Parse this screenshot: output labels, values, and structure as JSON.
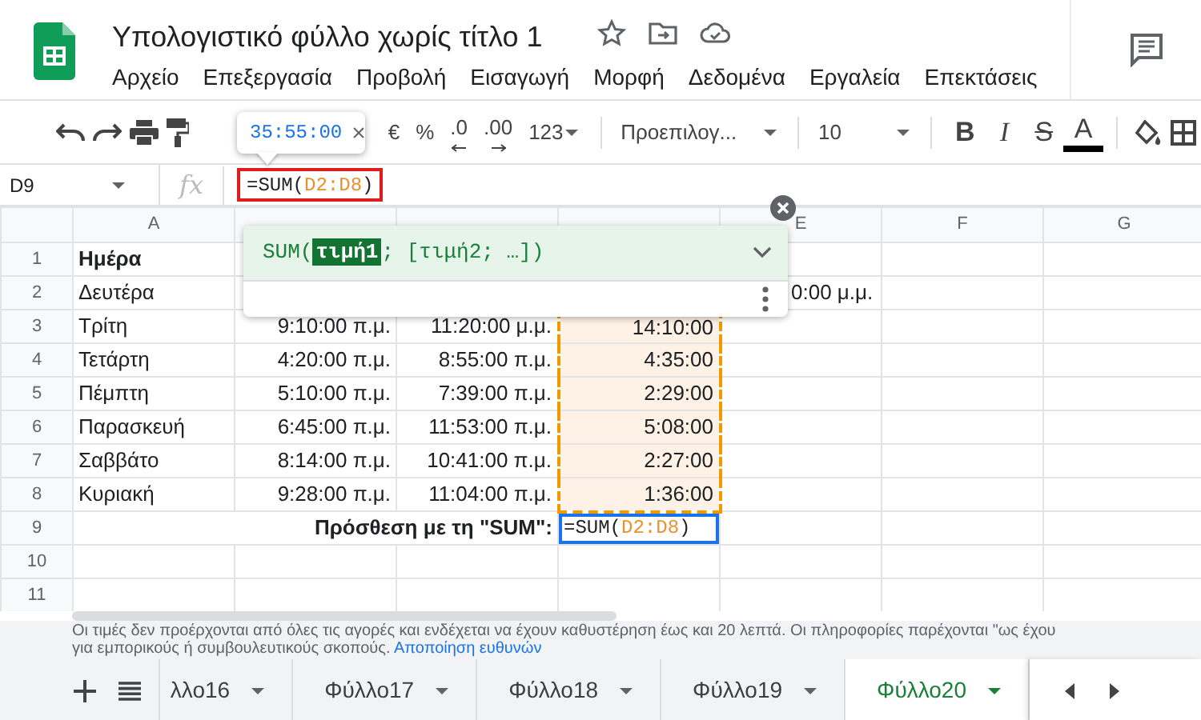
{
  "document": {
    "title": "Υπολογιστικό φύλλο χωρίς τίτλο 1"
  },
  "menu": [
    {
      "label": "Αρχείο"
    },
    {
      "label": "Επεξεργασία"
    },
    {
      "label": "Προβολή"
    },
    {
      "label": "Εισαγωγή"
    },
    {
      "label": "Μορφή"
    },
    {
      "label": "Δεδομένα"
    },
    {
      "label": "Εργαλεία"
    },
    {
      "label": "Επεκτάσεις"
    }
  ],
  "toolbar": {
    "number_formats": [
      {
        "text": "€",
        "kind": "plain"
      },
      {
        "text": "%",
        "kind": "plain"
      },
      {
        "text": ".0",
        "kind": "decrease"
      },
      {
        "text": ".00",
        "kind": "increase"
      },
      {
        "text": "123",
        "kind": "dropdown"
      }
    ],
    "font": "Προεπιλογ...",
    "font_size": "10",
    "text_styles": [
      {
        "text": "B",
        "kind": "bold"
      },
      {
        "text": "I",
        "kind": "italic"
      },
      {
        "text": "S",
        "kind": "strike"
      },
      {
        "text": "A",
        "kind": "color"
      }
    ]
  },
  "value_tooltip": {
    "text": "35:55:00",
    "close": "×"
  },
  "formula_bar": {
    "cell_ref": "D9",
    "fx": "fx",
    "formula": [
      {
        "text": "=SUM(",
        "kind": "plain"
      },
      {
        "text": "D2:D8",
        "kind": "ref"
      },
      {
        "text": ")",
        "kind": "plain"
      }
    ]
  },
  "columns": [
    {
      "label": "A"
    },
    {},
    {},
    {},
    {
      "label": "E"
    },
    {
      "label": "F"
    },
    {
      "label": "G"
    }
  ],
  "rows": [
    {
      "number": "1",
      "cells": [
        {
          "text": "Ημέρα",
          "kind": "header"
        },
        null,
        null,
        null,
        null,
        null,
        null
      ]
    },
    {
      "number": "2",
      "cells": [
        {
          "text": "Δευτέρα",
          "kind": "text"
        },
        null,
        null,
        null,
        {
          "text": "0:00 μ.μ.",
          "kind": "overflow"
        },
        null,
        null
      ]
    },
    {
      "number": "3",
      "cells": [
        {
          "text": "Τρίτη",
          "kind": "text"
        },
        {
          "text": "9:10:00 π.μ.",
          "kind": "time"
        },
        {
          "text": "11:20:00 μ.μ.",
          "kind": "time"
        },
        {
          "text": "14:10:00",
          "kind": "duration",
          "in_range": true
        },
        null,
        null,
        null
      ]
    },
    {
      "number": "4",
      "cells": [
        {
          "text": "Τετάρτη",
          "kind": "text"
        },
        {
          "text": "4:20:00 π.μ.",
          "kind": "time"
        },
        {
          "text": "8:55:00 π.μ.",
          "kind": "time"
        },
        {
          "text": "4:35:00",
          "kind": "duration",
          "in_range": true
        },
        null,
        null,
        null
      ]
    },
    {
      "number": "5",
      "cells": [
        {
          "text": "Πέμπτη",
          "kind": "text"
        },
        {
          "text": "5:10:00 π.μ.",
          "kind": "time"
        },
        {
          "text": "7:39:00 π.μ.",
          "kind": "time"
        },
        {
          "text": "2:29:00",
          "kind": "duration",
          "in_range": true
        },
        null,
        null,
        null
      ]
    },
    {
      "number": "6",
      "cells": [
        {
          "text": "Παρασκευή",
          "kind": "text"
        },
        {
          "text": "6:45:00 π.μ.",
          "kind": "time"
        },
        {
          "text": "11:53:00 π.μ.",
          "kind": "time"
        },
        {
          "text": "5:08:00",
          "kind": "duration",
          "in_range": true
        },
        null,
        null,
        null
      ]
    },
    {
      "number": "7",
      "cells": [
        {
          "text": "Σαββάτο",
          "kind": "text"
        },
        {
          "text": "8:14:00 π.μ.",
          "kind": "time"
        },
        {
          "text": "10:41:00 π.μ.",
          "kind": "time"
        },
        {
          "text": "2:27:00",
          "kind": "duration",
          "in_range": true
        },
        null,
        null,
        null
      ]
    },
    {
      "number": "8",
      "cells": [
        {
          "text": "Κυριακή",
          "kind": "text"
        },
        {
          "text": "9:28:00 π.μ.",
          "kind": "time"
        },
        {
          "text": "11:04:00 π.μ.",
          "kind": "time"
        },
        {
          "text": "1:36:00",
          "kind": "duration",
          "in_range": true
        },
        null,
        null,
        null
      ]
    },
    {
      "number": "9",
      "cells": [
        {
          "text": "Πρόσθεση με τη \"SUM\":",
          "kind": "label"
        },
        null,
        null,
        {
          "kind": "formula",
          "selected": true,
          "formula": [
            {
              "text": "=SUM(",
              "kind": "plain"
            },
            {
              "text": "D2:D8",
              "kind": "ref"
            },
            {
              "text": ")",
              "kind": "plain"
            }
          ]
        },
        null,
        null,
        null
      ]
    },
    {
      "number": "10",
      "cells": [
        null,
        null,
        null,
        null,
        null,
        null,
        null
      ]
    },
    {
      "number": "11",
      "cells": [
        null,
        null,
        null,
        null,
        null,
        null,
        null
      ]
    }
  ],
  "function_help": {
    "signature": [
      {
        "text": "SUM(",
        "kind": "plain"
      },
      {
        "text": "τιμή1",
        "kind": "active"
      },
      {
        "text": "; [τιμή2; …])",
        "kind": "plain"
      }
    ]
  },
  "notice": {
    "text": "Οι τιμές δεν προέρχονται από όλες τις αγορές και ενδέχεται να έχουν καθυστέρηση έως και 20 λεπτά. Οι πληροφορίες παρέχονται \"ως έχου",
    "text_2": "για εμπορικούς ή συμβουλευτικούς σκοπούς.",
    "link": "Αποποίηση ευθυνών"
  },
  "sheets": [
    {
      "label": "λλο16",
      "selected": false
    },
    {
      "label": "Φύλλο17",
      "selected": false
    },
    {
      "label": "Φύλλο18",
      "selected": false
    },
    {
      "label": "Φύλλο19",
      "selected": false
    },
    {
      "label": "Φύλλο20",
      "selected": true
    }
  ]
}
